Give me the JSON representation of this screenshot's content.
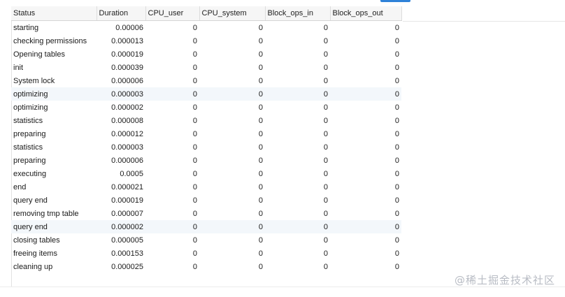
{
  "columns": [
    "Status",
    "Duration",
    "CPU_user",
    "CPU_system",
    "Block_ops_in",
    "Block_ops_out"
  ],
  "rows": [
    {
      "status": "starting",
      "duration": "0.00006",
      "cpu_user": "0",
      "cpu_system": "0",
      "block_ops_in": "0",
      "block_ops_out": "0"
    },
    {
      "status": "checking permissions",
      "duration": "0.000013",
      "cpu_user": "0",
      "cpu_system": "0",
      "block_ops_in": "0",
      "block_ops_out": "0"
    },
    {
      "status": "Opening tables",
      "duration": "0.000019",
      "cpu_user": "0",
      "cpu_system": "0",
      "block_ops_in": "0",
      "block_ops_out": "0"
    },
    {
      "status": "init",
      "duration": "0.000039",
      "cpu_user": "0",
      "cpu_system": "0",
      "block_ops_in": "0",
      "block_ops_out": "0"
    },
    {
      "status": "System lock",
      "duration": "0.000006",
      "cpu_user": "0",
      "cpu_system": "0",
      "block_ops_in": "0",
      "block_ops_out": "0"
    },
    {
      "status": "optimizing",
      "duration": "0.000003",
      "cpu_user": "0",
      "cpu_system": "0",
      "block_ops_in": "0",
      "block_ops_out": "0"
    },
    {
      "status": "optimizing",
      "duration": "0.000002",
      "cpu_user": "0",
      "cpu_system": "0",
      "block_ops_in": "0",
      "block_ops_out": "0"
    },
    {
      "status": "statistics",
      "duration": "0.000008",
      "cpu_user": "0",
      "cpu_system": "0",
      "block_ops_in": "0",
      "block_ops_out": "0"
    },
    {
      "status": "preparing",
      "duration": "0.000012",
      "cpu_user": "0",
      "cpu_system": "0",
      "block_ops_in": "0",
      "block_ops_out": "0"
    },
    {
      "status": "statistics",
      "duration": "0.000003",
      "cpu_user": "0",
      "cpu_system": "0",
      "block_ops_in": "0",
      "block_ops_out": "0"
    },
    {
      "status": "preparing",
      "duration": "0.000006",
      "cpu_user": "0",
      "cpu_system": "0",
      "block_ops_in": "0",
      "block_ops_out": "0"
    },
    {
      "status": "executing",
      "duration": "0.0005",
      "cpu_user": "0",
      "cpu_system": "0",
      "block_ops_in": "0",
      "block_ops_out": "0"
    },
    {
      "status": "end",
      "duration": "0.000021",
      "cpu_user": "0",
      "cpu_system": "0",
      "block_ops_in": "0",
      "block_ops_out": "0"
    },
    {
      "status": "query end",
      "duration": "0.000019",
      "cpu_user": "0",
      "cpu_system": "0",
      "block_ops_in": "0",
      "block_ops_out": "0"
    },
    {
      "status": "removing tmp table",
      "duration": "0.000007",
      "cpu_user": "0",
      "cpu_system": "0",
      "block_ops_in": "0",
      "block_ops_out": "0"
    },
    {
      "status": "query end",
      "duration": "0.000002",
      "cpu_user": "0",
      "cpu_system": "0",
      "block_ops_in": "0",
      "block_ops_out": "0"
    },
    {
      "status": "closing tables",
      "duration": "0.000005",
      "cpu_user": "0",
      "cpu_system": "0",
      "block_ops_in": "0",
      "block_ops_out": "0"
    },
    {
      "status": "freeing items",
      "duration": "0.000153",
      "cpu_user": "0",
      "cpu_system": "0",
      "block_ops_in": "0",
      "block_ops_out": "0"
    },
    {
      "status": "cleaning up",
      "duration": "0.000025",
      "cpu_user": "0",
      "cpu_system": "0",
      "block_ops_in": "0",
      "block_ops_out": "0"
    }
  ],
  "watermark": "@稀土掘金技术社区",
  "colors": {
    "accent": "#2f82d8",
    "row_alt": "#f3f7fb",
    "header_bg": "#f6f6f6"
  }
}
